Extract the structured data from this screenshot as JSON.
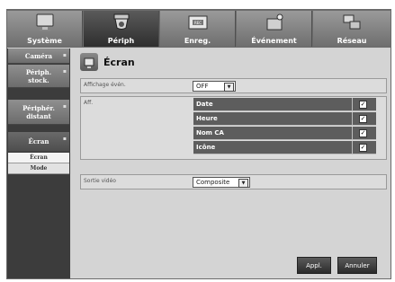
{
  "tabs": [
    {
      "label": "Système",
      "icon": "monitor-icon"
    },
    {
      "label": "Périph",
      "icon": "camera-icon"
    },
    {
      "label": "Enreg.",
      "icon": "rec-icon"
    },
    {
      "label": "Événement",
      "icon": "alarm-icon"
    },
    {
      "label": "Réseau",
      "icon": "network-icon"
    }
  ],
  "sidebar": {
    "items": [
      {
        "label": "Caméra"
      },
      {
        "label": "Périph.\nstock."
      },
      {
        "label": "Périphér.\ndistant"
      },
      {
        "label": "Écran"
      }
    ],
    "subitems": [
      {
        "label": "Écran"
      },
      {
        "label": "Mode"
      }
    ]
  },
  "page": {
    "title": "Écran"
  },
  "form": {
    "event_display_label": "Affichage évén.",
    "event_display_value": "OFF",
    "aff_label": "Aff.",
    "aff_items": [
      {
        "label": "Date",
        "checked": "✓"
      },
      {
        "label": "Heure",
        "checked": "✓"
      },
      {
        "label": "Nom CA",
        "checked": "✓"
      },
      {
        "label": "Icône",
        "checked": "✓"
      }
    ],
    "video_out_label": "Sortie vidéo",
    "video_out_value": "Composite"
  },
  "buttons": {
    "apply": "Appl.",
    "cancel": "Annuler"
  },
  "colors": {
    "accent": "#3a3a3a",
    "panel": "#d4d4d4"
  }
}
